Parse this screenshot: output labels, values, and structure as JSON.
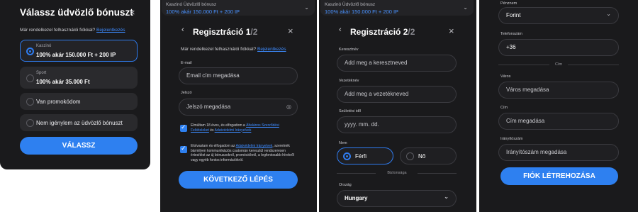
{
  "panel1": {
    "title": "Válassz üdvözlő bónuszt",
    "close": "×",
    "have_account": "Már rendelkezel felhasználói fiókkal?",
    "login_link": "Bejelentkezés",
    "options": [
      {
        "label": "Kaszinó",
        "value": "100% akár 150.000 Ft + 200 IP",
        "selected": true
      },
      {
        "label": "Sport",
        "value": "100% akár 35.000 Ft",
        "selected": false
      },
      {
        "text": "Van promokódom",
        "selected": false
      },
      {
        "text": "Nem igénylem az üdvözlő bónuszt",
        "selected": false
      }
    ],
    "choose_button": "VÁLASSZ"
  },
  "bonus_bar": {
    "label": "Kaszinó Üdvözlő bónusz",
    "value": "100% akár 150.000 Ft + 200 IP",
    "chev": "⌄"
  },
  "panel2": {
    "back": "‹",
    "title_main": "Regisztráció 1",
    "title_sep": "/2",
    "close": "×",
    "have_account": "Már rendelkezel felhasználói fiókkal?",
    "login_link": "Bejelentkezés",
    "email_label": "E-mail",
    "email_placeholder": "Email cím megadása",
    "password_label": "Jelszó",
    "password_placeholder": "Jelszó megadása",
    "eye_icon": "◎",
    "terms1_a": "Elmúltam 18 éves, és elfogadom a",
    "terms1_link1": "Általános Szerződési Feltételeket",
    "terms1_b": "és",
    "terms1_link2": "Adatvédelmi Irányelvek",
    "terms2_a": "Elolvastam és elfogadom az",
    "terms2_link": "Adatvédelmi Irányelvek",
    "terms2_b": ", szeretnék bármilyen kommunikációs csatornán keresztül rendszeresen értesítést az új bónuszokról, promóciókról, a legfontosabb hírekről vagy egyéb fontos információkról.",
    "next_button": "KÖVETKEZŐ LÉPÉS"
  },
  "panel3": {
    "back": "‹",
    "title_main": "Regisztráció 2",
    "title_sep": "/2",
    "close": "×",
    "firstname_label": "Keresztnév",
    "firstname_placeholder": "Add meg a keresztneved",
    "lastname_label": "Vezetéknév",
    "lastname_placeholder": "Add meg a vezetékneved",
    "birth_label": "Születési idő",
    "birth_placeholder": "yyyy. mm. dd.",
    "gender_label": "Nem",
    "gender_male": "Férfi",
    "gender_female": "Nő",
    "security_sep": "Biztonsága",
    "country_label": "Ország",
    "country_value": "Hungary",
    "chev": "⌄"
  },
  "panel4": {
    "currency_label": "Pénznem",
    "currency_value": "Forint",
    "phone_label": "Telefonszám",
    "phone_value": "+36",
    "address_sep": "Cím",
    "city_label": "Város",
    "city_placeholder": "Város megadása",
    "address_label": "Cím",
    "address_placeholder": "Cím megadása",
    "zip_label": "Irányítószám",
    "zip_placeholder": "Irányítószám megadása",
    "create_button": "FIÓK LÉTREHOZÁSA",
    "chev": "⌄"
  }
}
